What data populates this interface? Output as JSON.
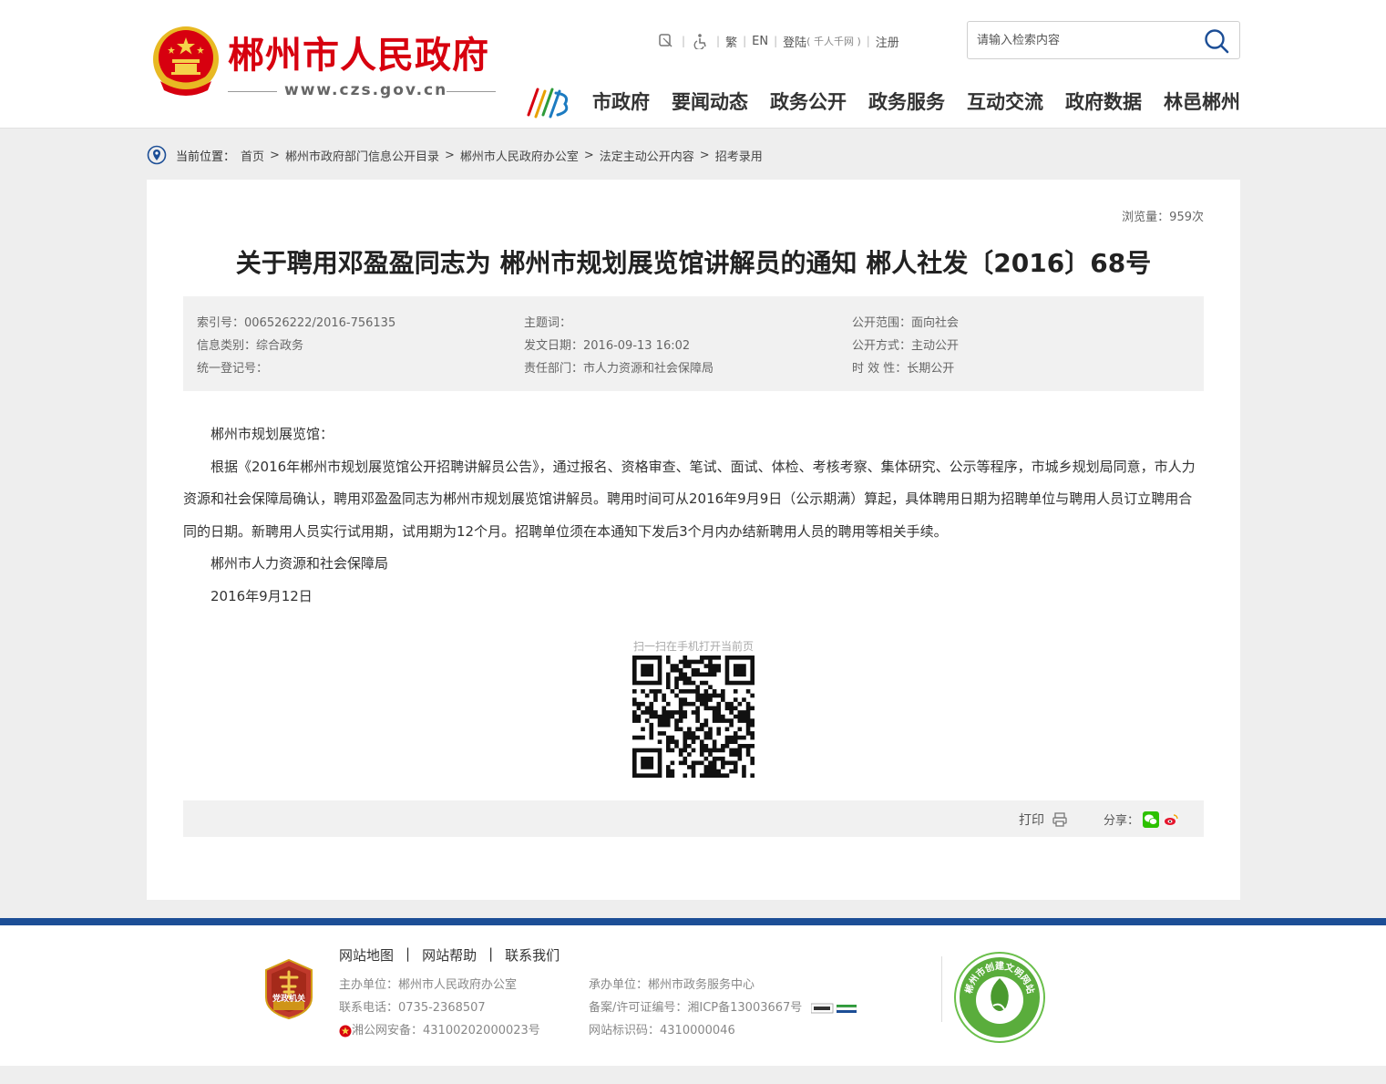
{
  "header": {
    "site_name": "郴州市人民政府",
    "site_url": "www.czs.gov.cn",
    "top_links": {
      "traditional": "繁",
      "english": "EN",
      "login": "登陆",
      "login_note": "( 千人千网 )",
      "register": "注册"
    },
    "search_placeholder": "请输入检索内容",
    "nav": [
      "市政府",
      "要闻动态",
      "政务公开",
      "政务服务",
      "互动交流",
      "政府数据",
      "林邑郴州"
    ]
  },
  "breadcrumb": {
    "label": "当前位置：",
    "items": [
      "首页",
      "郴州市政府部门信息公开目录",
      "郴州市人民政府办公室",
      "法定主动公开内容",
      "招考录用"
    ],
    "separator": ">"
  },
  "article": {
    "views": "浏览量：959次",
    "title": "关于聘用邓盈盈同志为 郴州市规划展览馆讲解员的通知 郴人社发〔2016〕68号",
    "meta": {
      "col1": [
        "索引号：006526222/2016-756135",
        "信息类别：综合政务",
        "统一登记号："
      ],
      "col2": [
        "主题词：",
        "发文日期：2016-09-13 16:02",
        "责任部门：市人力资源和社会保障局"
      ],
      "col3": [
        "公开范围：面向社会",
        "公开方式：主动公开",
        "时 效 性：长期公开"
      ]
    },
    "paragraphs": [
      "郴州市规划展览馆：",
      "根据《2016年郴州市规划展览馆公开招聘讲解员公告》，通过报名、资格审查、笔试、面试、体检、考核考察、集体研究、公示等程序，市城乡规划局同意，市人力资源和社会保障局确认，聘用邓盈盈同志为郴州市规划展览馆讲解员。聘用时间可从2016年9月9日（公示期满）算起，具体聘用日期为招聘单位与聘用人员订立聘用合同的日期。新聘用人员实行试用期，试用期为12个月。招聘单位须在本通知下发后3个月内办结新聘用人员的聘用等相关手续。",
      "郴州市人力资源和社会保障局",
      "2016年9月12日"
    ],
    "qr_caption": "扫一扫在手机打开当前页",
    "print_label": "打印",
    "share_label": "分享："
  },
  "footer": {
    "links": [
      "网站地图",
      "网站帮助",
      "联系我们"
    ],
    "info_left": [
      "主办单位：郴州市人民政府办公室",
      "联系电话：0735-2368507",
      "湘公网安备：43100202000023号"
    ],
    "info_right": [
      "承办单位：郴州市政务服务中心",
      "备案/许可证编号：湘ICP备13003667号",
      "网站标识码：4310000046"
    ],
    "party_badge_text": "党政机关",
    "civ_badge_text": "郴州市创建文明网站"
  },
  "colors": {
    "brand_red": "#d7000f",
    "footer_blue": "#1c4e96",
    "wechat_green": "#2dc100"
  }
}
